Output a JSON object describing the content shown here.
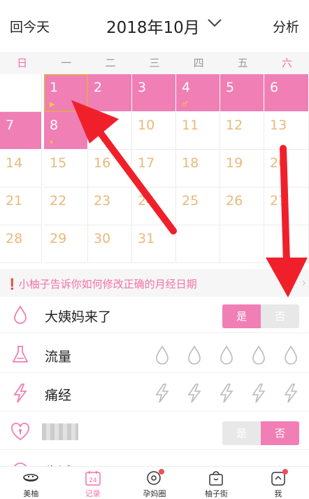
{
  "header": {
    "back_label": "回今天",
    "month_label": "2018年10月",
    "analysis_label": "分析"
  },
  "weekdays": [
    "日",
    "一",
    "二",
    "三",
    "四",
    "五",
    "六"
  ],
  "calendar": {
    "weeks": [
      [
        "",
        "1",
        "2",
        "3",
        "4",
        "5",
        "6"
      ],
      [
        "7",
        "8",
        "9",
        "10",
        "11",
        "12",
        "13"
      ],
      [
        "14",
        "15",
        "16",
        "17",
        "18",
        "19",
        "20"
      ],
      [
        "21",
        "22",
        "23",
        "24",
        "25",
        "26",
        "27"
      ],
      [
        "28",
        "29",
        "30",
        "31",
        "",
        "",
        ""
      ]
    ],
    "period_days": [
      "1",
      "2",
      "3",
      "4",
      "5",
      "6",
      "7",
      "8"
    ],
    "selected_day": "1",
    "day_marks": {
      "1": "▶",
      "4": "♂",
      "8": "⏸"
    }
  },
  "tip": {
    "text": "❗小柚子告诉你如何修改正确的月经日期",
    "arrow": "›"
  },
  "records": {
    "period": {
      "label": "大姨妈来了",
      "yes": "是",
      "no": "否",
      "selected": "yes"
    },
    "flow": {
      "label": "流量",
      "levels": 5
    },
    "pain": {
      "label": "痛经",
      "levels": 5
    },
    "love": {
      "yes": "是",
      "no": "否",
      "selected": "no"
    },
    "habits": {
      "label": "生活"
    }
  },
  "nav": {
    "items": [
      {
        "label": "美柚",
        "icon": "bowl-icon"
      },
      {
        "label": "记录",
        "icon": "calendar-24-icon"
      },
      {
        "label": "孕妈圈",
        "icon": "chat-bubble-icon"
      },
      {
        "label": "柚子街",
        "icon": "shopping-bag-icon"
      },
      {
        "label": "我",
        "icon": "profile-icon"
      }
    ],
    "active": "记录",
    "calendar_icon_text": "24"
  },
  "colors": {
    "accent": "#f07fb5",
    "accent_text": "#f272a8",
    "day_number": "#e8b97a",
    "annotation_arrow": "#f0202a"
  }
}
